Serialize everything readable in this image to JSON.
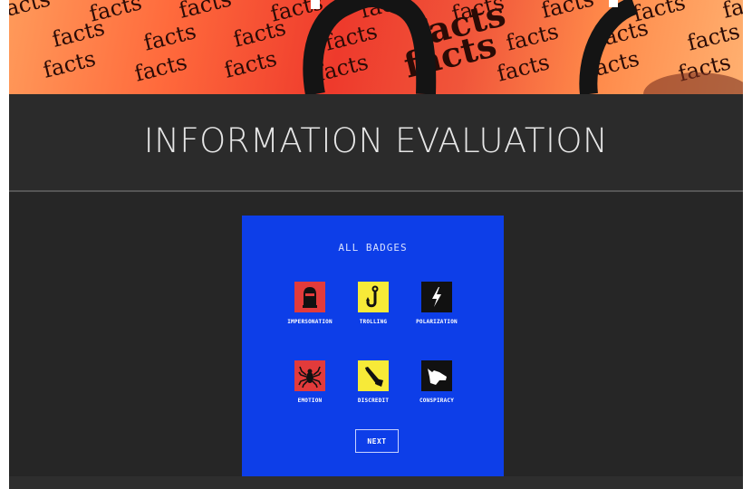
{
  "banner": {
    "word": "facts",
    "colors": {
      "orange": "#ff7a3c",
      "red": "#ee3a2c",
      "text": "#2a0b06"
    }
  },
  "header": {
    "title": "INFORMATION EVALUATION"
  },
  "panel": {
    "title": "ALL BADGES",
    "background": "#0d3ee8",
    "badges": [
      {
        "label": "IMPERSONATION",
        "icon": "masked-head-icon",
        "color": "#e23b3b"
      },
      {
        "label": "TROLLING",
        "icon": "fishing-hook-icon",
        "color": "#f7ea38"
      },
      {
        "label": "POLARIZATION",
        "icon": "lightning-bolt-icon",
        "color": "#111111"
      },
      {
        "label": "EMOTION",
        "icon": "spider-icon",
        "color": "#e23b3b"
      },
      {
        "label": "DISCREDIT",
        "icon": "club-icon",
        "color": "#f7ea38"
      },
      {
        "label": "CONSPIRACY",
        "icon": "goat-head-icon",
        "color": "#111111"
      }
    ],
    "next_label": "NEXT"
  }
}
